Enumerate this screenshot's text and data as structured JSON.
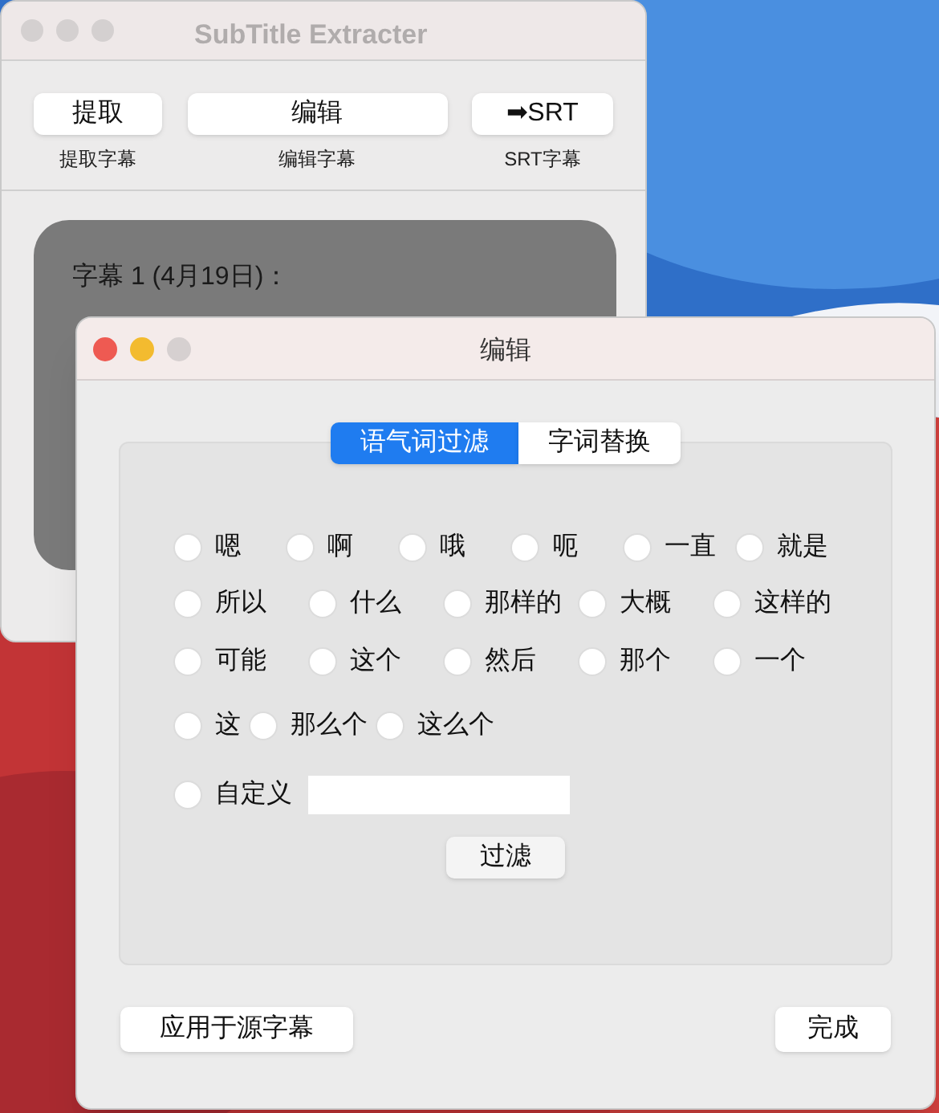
{
  "main_window": {
    "title": "SubTitle Extracter",
    "toolbar": [
      {
        "label": "提取",
        "caption": "提取字幕"
      },
      {
        "label": "编辑",
        "caption": "编辑字幕"
      },
      {
        "label": "➡SRT",
        "caption": "SRT字幕"
      }
    ],
    "subtitle_heading": "字幕 1 (4月19日)："
  },
  "dialog": {
    "title": "编辑",
    "tabs": [
      {
        "label": "语气词过滤",
        "selected": true
      },
      {
        "label": "字词替换",
        "selected": false
      }
    ],
    "filter_words": [
      [
        {
          "label": "嗯",
          "selected": false
        },
        {
          "label": "啊",
          "selected": false
        },
        {
          "label": "哦",
          "selected": false
        },
        {
          "label": "呃",
          "selected": false
        },
        {
          "label": "一直",
          "selected": false
        },
        {
          "label": "就是",
          "selected": false
        }
      ],
      [
        {
          "label": "所以",
          "selected": false
        },
        {
          "label": "什么",
          "selected": false
        },
        {
          "label": "那样的",
          "selected": false
        },
        {
          "label": "大概",
          "selected": false
        },
        {
          "label": "这样的",
          "selected": false
        }
      ],
      [
        {
          "label": "可能",
          "selected": false
        },
        {
          "label": "这个",
          "selected": false
        },
        {
          "label": "然后",
          "selected": false
        },
        {
          "label": "那个",
          "selected": false
        },
        {
          "label": "一个",
          "selected": false
        }
      ],
      [
        {
          "label": "这",
          "selected": false
        },
        {
          "label": "那么个",
          "selected": false
        },
        {
          "label": "这么个",
          "selected": false
        }
      ]
    ],
    "custom": {
      "label": "自定义",
      "selected": false
    },
    "filter_button": "过滤",
    "apply_button": "应用于源字幕",
    "done_button": "完成"
  }
}
